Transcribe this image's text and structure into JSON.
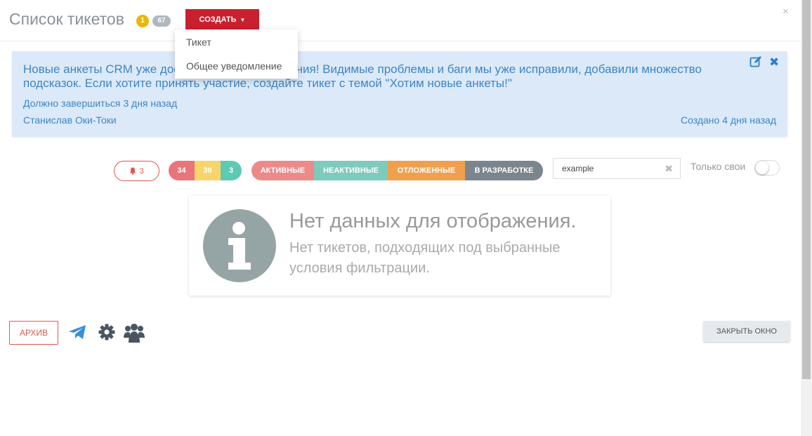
{
  "header": {
    "title": "Список тикетов",
    "badge_unread": "1",
    "badge_total": "67",
    "create_label": "СОЗДАТЬ",
    "close_symbol": "×"
  },
  "create_menu": {
    "items": [
      {
        "label": "Тикет"
      },
      {
        "label": "Общее уведомление"
      }
    ]
  },
  "notice": {
    "text": "Новые анкеты CRM уже доступны для тестирования! Видимые проблемы и баги мы уже исправили, добавили множество подсказок. Если хотите принять участие, создайте тикет с темой \"Хотим новые анкеты!\"",
    "deadline": "Должно завершиться 3 дня назад",
    "author": "Станислав Оки-Токи",
    "created": "Создано 4 дня назад",
    "icons": [
      "edit-icon",
      "close-icon"
    ]
  },
  "filters": {
    "notifications_count": "3",
    "counts": [
      "34",
      "30",
      "3"
    ],
    "statuses": [
      {
        "label": "АКТИВНЫЕ",
        "color": "#ec8a8a"
      },
      {
        "label": "НЕАКТИВНЫЕ",
        "color": "#7dcbbd"
      },
      {
        "label": "ОТЛОЖЕННЫЕ",
        "color": "#f0a04d"
      },
      {
        "label": "В РАЗРАБОТКЕ",
        "color": "#7b858d"
      }
    ],
    "search_value": "example",
    "own_only_label": "Только свои",
    "own_only": false
  },
  "empty_state": {
    "title": "Нет данных для отображения.",
    "subtitle": "Нет тикетов, подходящих под выбранные условия фильтрации."
  },
  "footer": {
    "archive_label": "АРХИВ",
    "icons": [
      "telegram-icon",
      "gear-icon",
      "users-icon"
    ],
    "close_window_label": "ЗАКРЫТЬ ОКНО"
  },
  "colors": {
    "accent_red": "#c8202e",
    "notice_bg": "#dce9f8",
    "notice_text": "#3d86c6"
  }
}
